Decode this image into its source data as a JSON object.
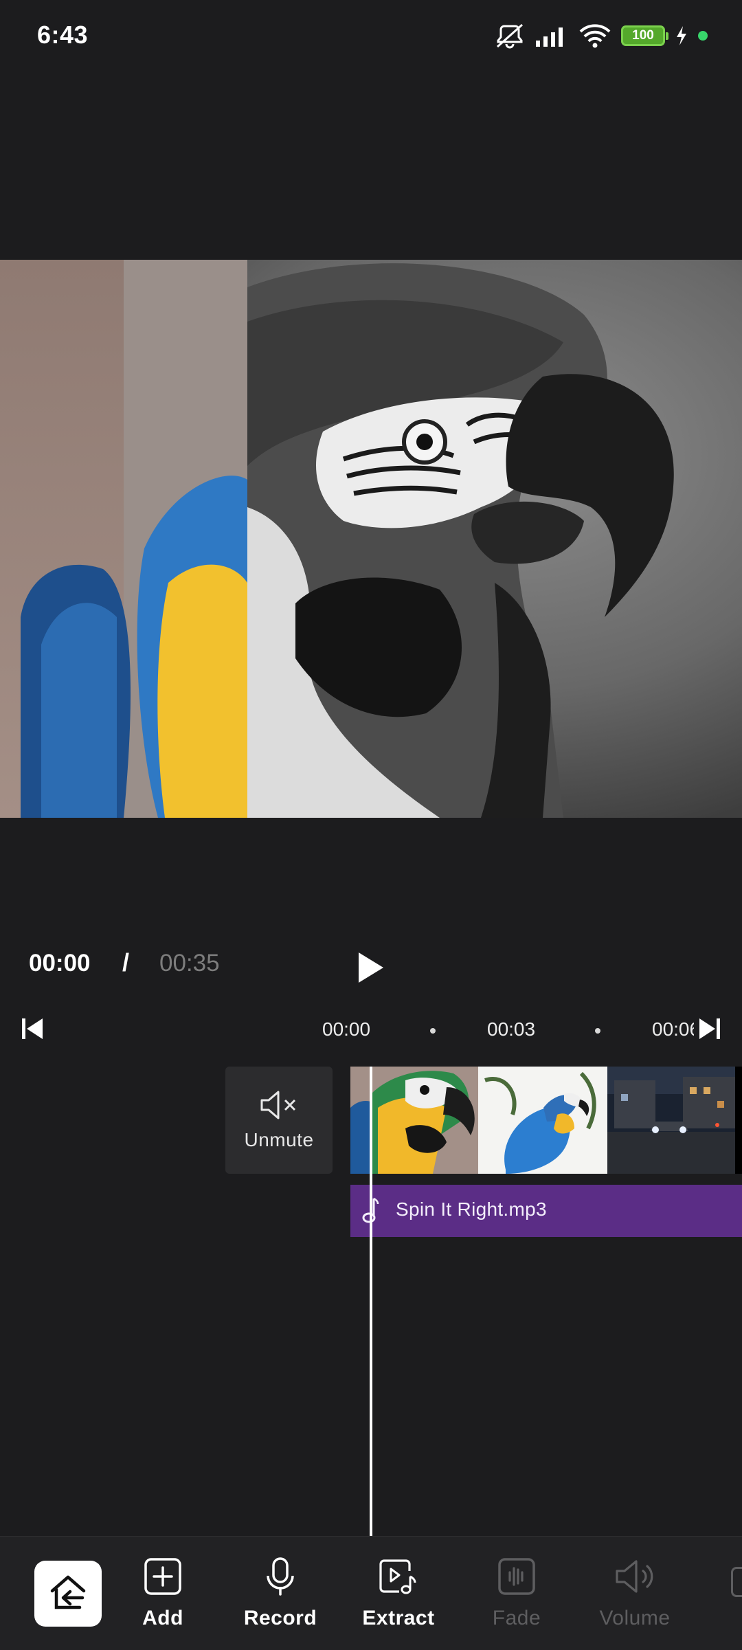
{
  "status_bar": {
    "time": "6:43",
    "battery": "100",
    "icons": [
      "mute-icon",
      "signal-icon",
      "wifi-icon",
      "battery-icon",
      "charging-icon",
      "notification-dot"
    ]
  },
  "player": {
    "current_time": "00:00",
    "separator": "/",
    "total_time": "00:35"
  },
  "timeline": {
    "ticks": [
      "00:00",
      "00:03",
      "00:06"
    ],
    "mute_button_label": "Unmute",
    "audio_track": "Spin It Right.mp3",
    "clips": [
      "parrot-bw-clip",
      "parrot-blue-clip",
      "night-street-clip"
    ]
  },
  "toolbar": {
    "items": [
      {
        "label": "Add",
        "icon": "plus-square-icon",
        "enabled": true
      },
      {
        "label": "Record",
        "icon": "microphone-icon",
        "enabled": true
      },
      {
        "label": "Extract",
        "icon": "extract-audio-icon",
        "enabled": true
      },
      {
        "label": "Fade",
        "icon": "fade-icon",
        "enabled": false
      },
      {
        "label": "Volume",
        "icon": "volume-icon",
        "enabled": false
      }
    ]
  },
  "colors": {
    "background": "#1c1c1e",
    "audio_track": "#5b2d86",
    "disabled_text": "#5e5e60",
    "battery": "#54a82b"
  }
}
